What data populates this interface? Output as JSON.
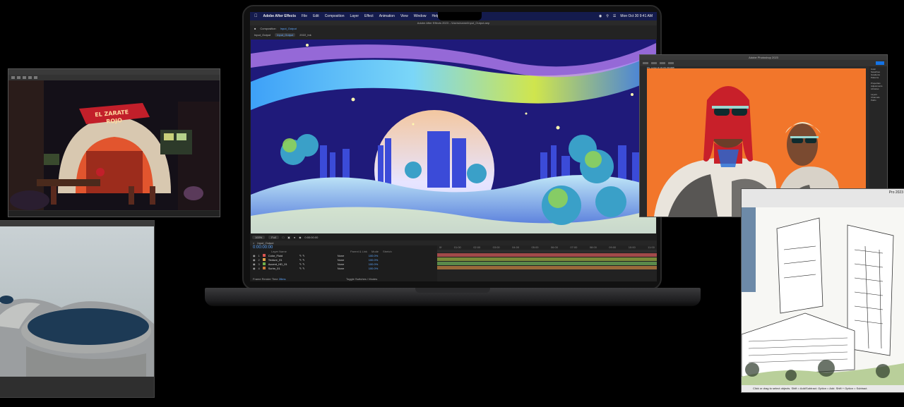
{
  "render_app": {
    "sign_text_line1": "EL ZARATE",
    "sign_text_line2": "ROJO"
  },
  "menubar": {
    "app_name": "Adobe After Effects",
    "items": [
      "File",
      "Edit",
      "Composition",
      "Layer",
      "Effect",
      "Animation",
      "View",
      "Window",
      "Help"
    ],
    "clock": "Mon Oct 30  9:41 AM"
  },
  "after_effects": {
    "window_title": "Adobe After Effects 2023 - /Users/name/Input_Output.aep",
    "composition_label": "Composition",
    "composition_name": "Input_Output",
    "tabs": [
      "Input_Output",
      "Input_Output",
      "2022_Ink"
    ],
    "zoom": "100%",
    "resolution": "Full",
    "timecode_small": "0:00:00:00",
    "timeline_tab": "Input_Output",
    "timecode": "0:00:00:00",
    "layer_header": {
      "name": "Layer Name",
      "parent": "Parent & Link",
      "mode": "Mode",
      "stretch": "Stretch"
    },
    "layers": [
      {
        "num": "1",
        "name": "Color_Fluid",
        "parent": "None",
        "pct": "100.0%",
        "color": "#d9534f"
      },
      {
        "num": "2",
        "name": "Texture_01",
        "parent": "None",
        "pct": "100.0%",
        "color": "#e0a34a"
      },
      {
        "num": "3",
        "name": "Accent_HD_01",
        "parent": "None",
        "pct": "100.0%",
        "color": "#6fb04a"
      },
      {
        "num": "4",
        "name": "Scrim_01",
        "parent": "None",
        "pct": "100.0%",
        "color": "#c97a3a"
      }
    ],
    "ruler": [
      "0f",
      "01:00",
      "02:00",
      "03:00",
      "04:00",
      "05:00",
      "06:00",
      "07:00",
      "08:00",
      "09:00",
      "10:00",
      "11:00"
    ],
    "frame_render_label": "Frame Render Time",
    "frame_render_value": "28ms",
    "toggle_label": "Toggle Switches / Modes"
  },
  "photoshop": {
    "window_title": "Adobe Photoshop 2023",
    "doc_tab": "PS_output @ 33.3% (RGB/8)",
    "panels": [
      "Color",
      "Swatches",
      "Gradients",
      "Patterns",
      "Properties",
      "Adjustments",
      "Libraries",
      "Layers",
      "Channels",
      "Paths"
    ]
  },
  "arch_app": {
    "title": "Pro 2023",
    "status": "Click or drag to select objects. Shift = Add/Subtract. Option = Add. Shift + Option = Subtract."
  },
  "colors": {
    "accent_blue": "#5fa8ff",
    "ps_canvas": "#f2762b",
    "menubar": "#141b4d"
  }
}
